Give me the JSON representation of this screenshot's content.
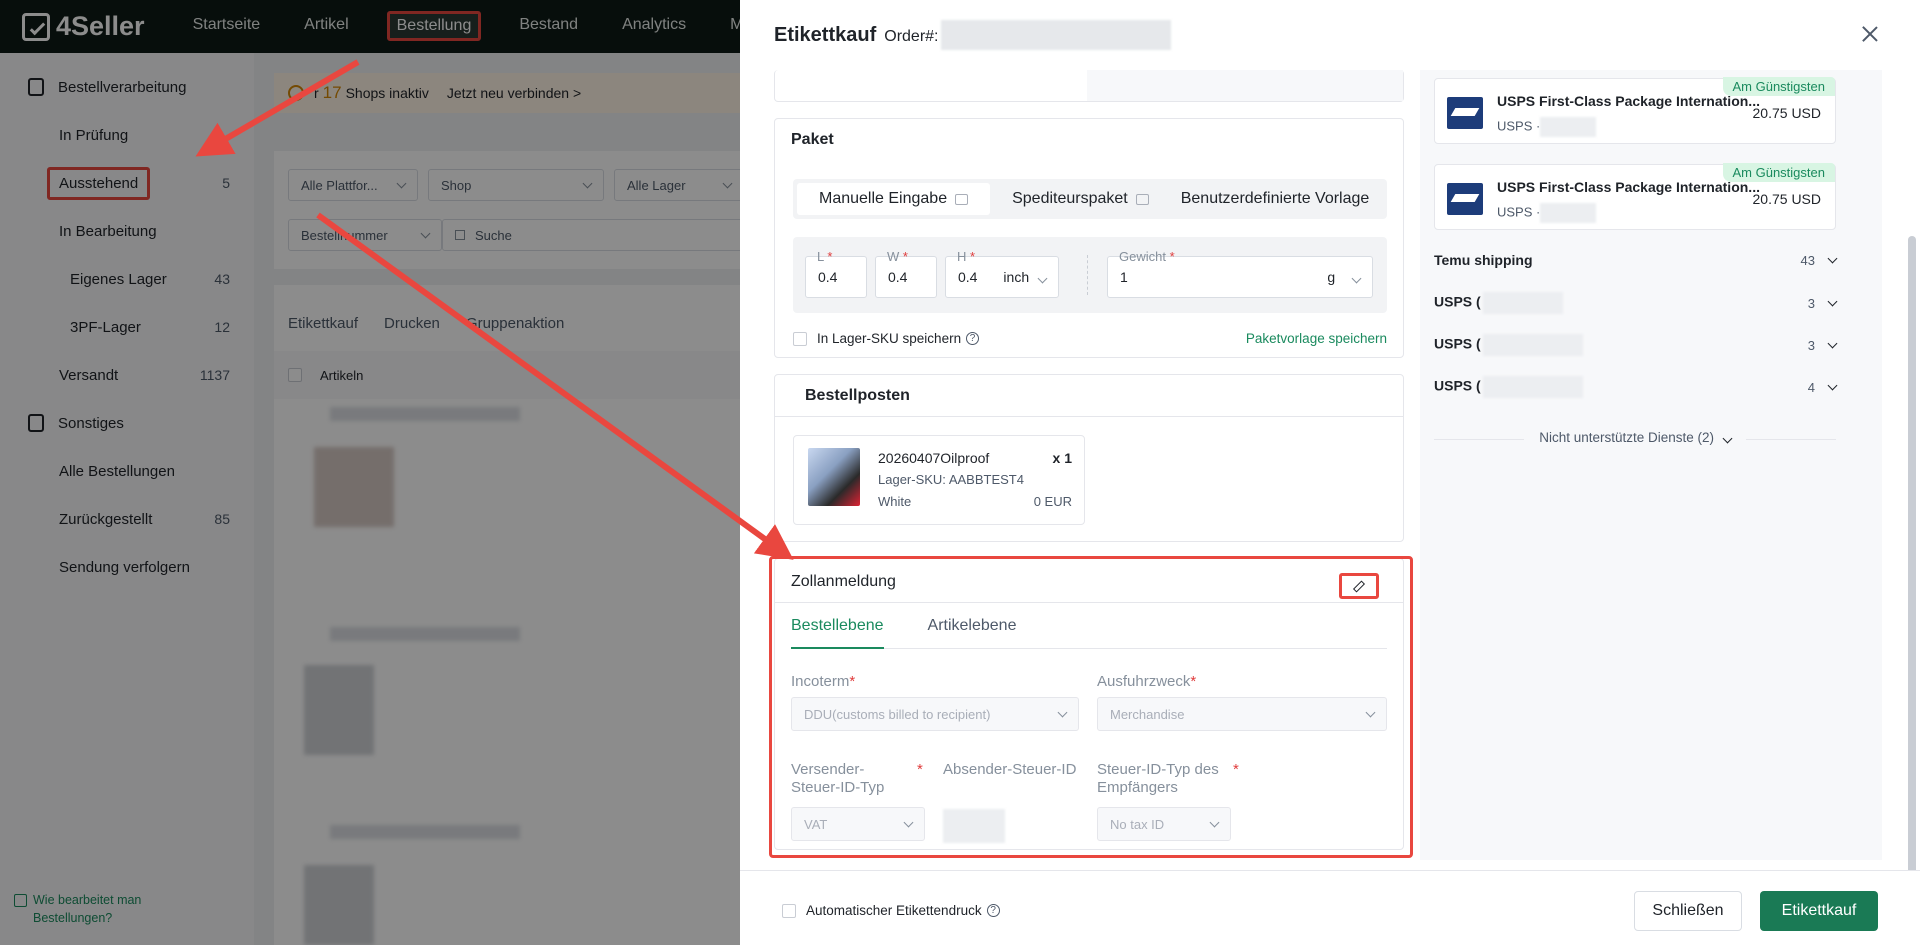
{
  "app": {
    "logo": "4Seller",
    "nav": [
      "Startseite",
      "Artikel",
      "Bestellung",
      "Bestand",
      "Analytics",
      "Ma"
    ],
    "nav_active": "Bestellung"
  },
  "sidebar": {
    "group1": "Bestellverarbeitung",
    "items1": [
      {
        "label": "In Prüfung",
        "count": ""
      },
      {
        "label": "Ausstehend",
        "count": "5"
      },
      {
        "label": "In Bearbeitung",
        "count": ""
      }
    ],
    "subitems": [
      {
        "label": "Eigenes Lager",
        "count": "43"
      },
      {
        "label": "3PF-Lager",
        "count": "12"
      }
    ],
    "shipped": {
      "label": "Versandt",
      "count": "1137"
    },
    "group2": "Sonstiges",
    "items2": [
      {
        "label": "Alle Bestellungen",
        "count": ""
      },
      {
        "label": "Zurückgestellt",
        "count": "85"
      },
      {
        "label": "Sendung verfolgern",
        "count": ""
      }
    ],
    "help_line1": "Wie bearbeitet man",
    "help_line2": "Bestellungen?"
  },
  "main": {
    "alert_prefix": "r",
    "alert_count": "17",
    "alert_text": "Shops inaktiv",
    "alert_link": "Jetzt neu verbinden >",
    "filters": [
      "Alle Plattfor...",
      "Shop",
      "Alle Lager"
    ],
    "search_field": "Bestellnummer",
    "search_placeholder": "Suche",
    "actions": [
      "Etikettkauf",
      "Drucken",
      "Gruppenaktion"
    ],
    "col_header": "Artikeln"
  },
  "drawer": {
    "title": "Etikettkauf",
    "order_label": "Order#:",
    "paket": {
      "title": "Paket",
      "tabs": [
        "Manuelle Eingabe",
        "Spediteurspaket",
        "Benutzerdefinierte Vorlage"
      ],
      "L_label": "L",
      "L_value": "0.4",
      "W_label": "W",
      "W_value": "0.4",
      "H_label": "H",
      "H_value": "0.4",
      "unit": "inch",
      "weight_label": "Gewicht",
      "weight_value": "1",
      "weight_unit": "g",
      "save_sku": "In Lager-SKU speichern",
      "save_template": "Paketvorlage speichern"
    },
    "items": {
      "title": "Bestellposten",
      "name": "20260407Oilproof",
      "qty": "x 1",
      "sku": "Lager-SKU: AABBTEST4",
      "color": "White",
      "price": "0 EUR"
    },
    "customs": {
      "title": "Zollanmeldung",
      "tabs": [
        "Bestellebene",
        "Artikelebene"
      ],
      "incoterm_label": "Incoterm",
      "incoterm_value": "DDU(customs billed to recipient)",
      "purpose_label": "Ausfuhrzweck",
      "purpose_value": "Merchandise",
      "sender_tax_type_label": "Versender-Steuer-ID-Typ",
      "sender_tax_type_value": "VAT",
      "sender_tax_id_label": "Absender-Steuer-ID",
      "recipient_tax_type_label": "Steuer-ID-Typ des Empfängers",
      "recipient_tax_type_value": "No tax ID"
    },
    "services": [
      {
        "badge": "Am Günstigsten",
        "name": "USPS First-Class Package Internation...",
        "carrier": "USPS ·",
        "price": "20.75 USD"
      },
      {
        "badge": "Am Günstigsten",
        "name": "USPS First-Class Package Internation...",
        "carrier": "USPS ·",
        "price": "20.75 USD"
      }
    ],
    "groups": [
      {
        "name": "Temu shipping",
        "count": "43"
      },
      {
        "name": "USPS (",
        "count": "3"
      },
      {
        "name": "USPS (",
        "count": "3"
      },
      {
        "name": "USPS (",
        "count": "4"
      }
    ],
    "unsupported": "Nicht unterstützte Dienste (2)",
    "footer": {
      "auto_print": "Automatischer Etikettendruck",
      "close_btn": "Schließen",
      "buy_btn": "Etikettkauf"
    }
  },
  "colors": {
    "accent": "#1a7a55",
    "highlight": "#e9473f",
    "badge_bg": "#d8f5e3"
  }
}
